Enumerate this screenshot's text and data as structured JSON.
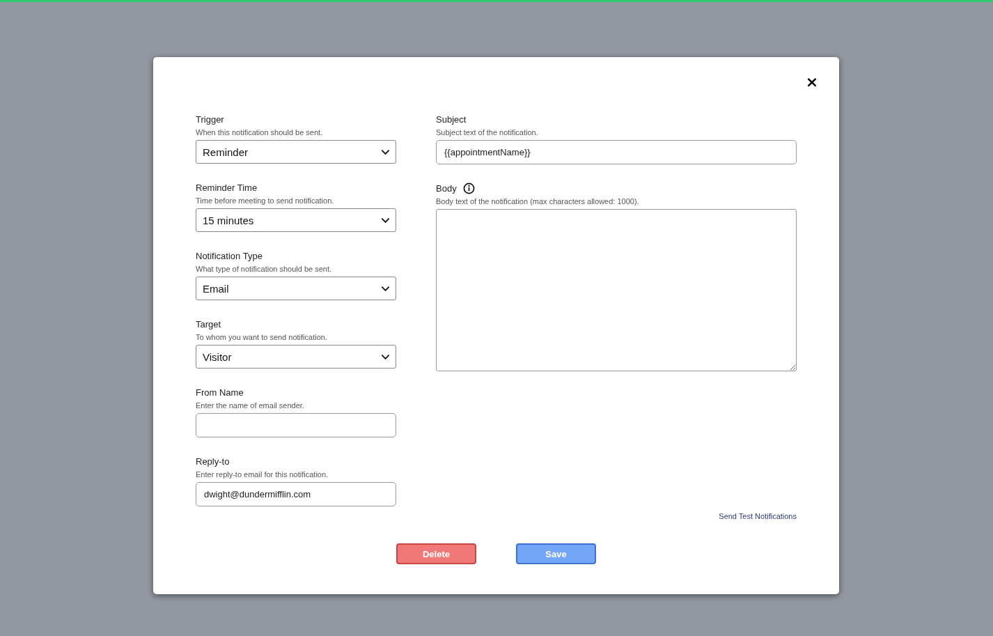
{
  "modal": {
    "close": "×"
  },
  "left_fields": [
    {
      "kind": "select",
      "label": "Trigger",
      "description": "When this notification should be sent.",
      "value": "Reminder"
    },
    {
      "kind": "select",
      "label": "Reminder Time",
      "description": "Time before meeting to send notification.",
      "value": "15 minutes"
    },
    {
      "kind": "select",
      "label": "Notification Type",
      "description": "What type of notification should be sent.",
      "value": "Email"
    },
    {
      "kind": "select",
      "label": "Target",
      "description": "To whom you want to send notification.",
      "value": "Visitor"
    },
    {
      "kind": "text",
      "label": "From Name",
      "description": "Enter the name of email sender."
    },
    {
      "kind": "text",
      "label": "Reply-to",
      "description": "Enter reply-to email for this notification.",
      "value": "dwight@dundermifflin.com"
    }
  ],
  "right_fields": [
    {
      "kind": "text",
      "label": "Subject",
      "description": "Subject text of the notification.",
      "value": "{{appointmentName}}"
    },
    {
      "kind": "textarea",
      "label": "Body",
      "info": true,
      "description": "Body text of the notification (max characters allowed: 1000)."
    }
  ],
  "test_link": "Send Test Notifications",
  "buttons": [
    {
      "kind": "danger",
      "label": "Delete"
    },
    {
      "kind": "primary",
      "label": "Save"
    }
  ]
}
